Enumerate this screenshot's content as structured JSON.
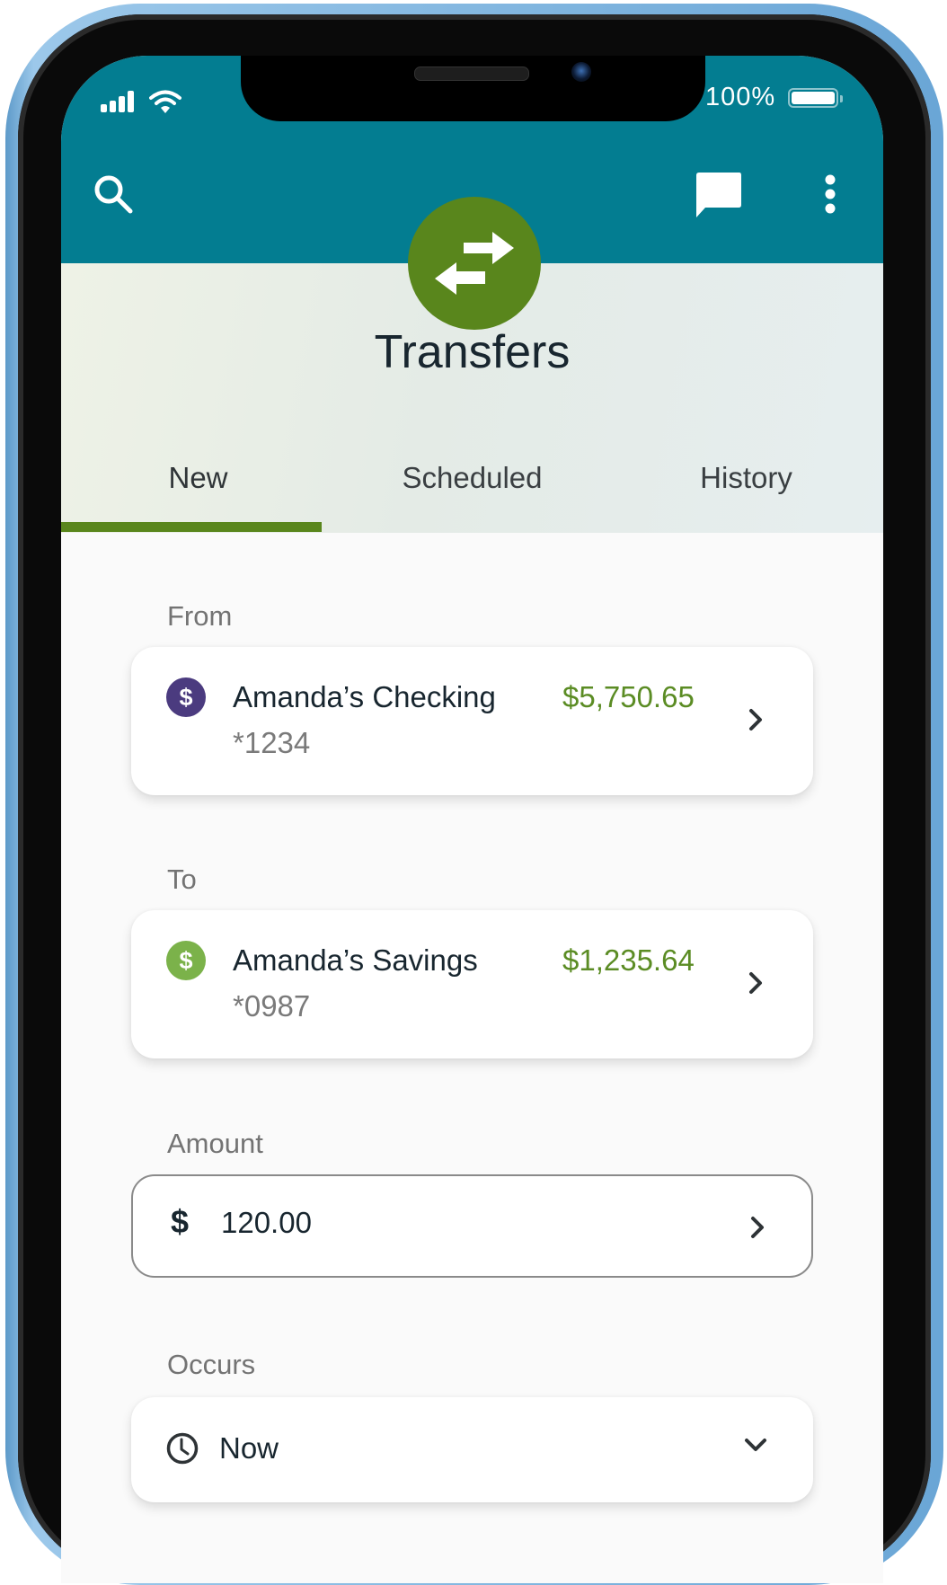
{
  "status_bar": {
    "battery_text": "100%",
    "battery_level": 1.0
  },
  "header": {
    "title": "Transfers",
    "icons": [
      "search-icon",
      "chat-icon",
      "more-vertical-icon",
      "transfer-arrows-icon"
    ]
  },
  "tabs": [
    {
      "label": "New",
      "active": true
    },
    {
      "label": "Scheduled",
      "active": false
    },
    {
      "label": "History",
      "active": false
    }
  ],
  "form": {
    "from": {
      "label": "From",
      "account_name": "Amanda’s Checking",
      "account_number": "*1234",
      "balance": "$5,750.65",
      "icon_symbol": "$",
      "icon_color": "#4b3b7f"
    },
    "to": {
      "label": "To",
      "account_name": "Amanda’s Savings",
      "account_number": "*0987",
      "balance": "$1,235.64",
      "icon_symbol": "$",
      "icon_color": "#7bb24a"
    },
    "amount": {
      "label": "Amount",
      "currency_symbol": "$",
      "value": "120.00"
    },
    "occurs": {
      "label": "Occurs",
      "value": "Now"
    }
  },
  "colors": {
    "header_teal": "#037d91",
    "accent_green": "#59861c",
    "balance_green": "#5b8c24"
  }
}
